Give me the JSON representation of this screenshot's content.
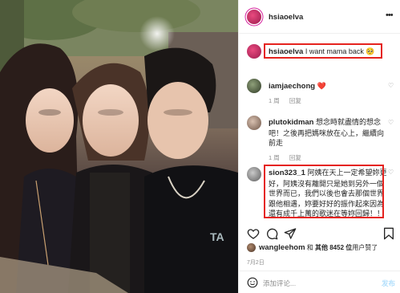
{
  "post": {
    "author": "hsiaoelva",
    "more_icon": "more-horizontal-icon"
  },
  "caption": {
    "user": "hsiaoelva",
    "text": "I want mama back 🥺"
  },
  "comments": [
    {
      "user": "iamjaechong",
      "text": "❤️",
      "time": "1 周",
      "reply": "回复"
    },
    {
      "user": "plutokidman",
      "text": "想念時就盡情的想念吧！之後再把媽咪放在心上，繼續向前走",
      "time": "1 周",
      "reply": "回复"
    },
    {
      "user": "sion323_1",
      "text": "阿姨在天上一定希望妳更好，阿姨沒有離開只是她到另外一個世界而已，我們以後也會去那個世界跟他相遇，妳要好好的振作起來因為還有成千上萬的歌迷在等妳回歸！！加油喔～～～～愛妳"
    }
  ],
  "actions": {
    "like_icon": "heart-outline-icon",
    "comment_icon": "comment-bubble-icon",
    "share_icon": "paper-plane-icon",
    "save_icon": "bookmark-icon"
  },
  "likes": {
    "user": "wangleehom",
    "connector": "和",
    "others": "其他 8452 位",
    "suffix": "用户赞了"
  },
  "date": "7月2日",
  "add_comment": {
    "placeholder": "添加评论...",
    "post_label": "发布",
    "emoji_icon": "smiley-face-icon"
  },
  "colors": {
    "highlight_box": "#e5231f",
    "heart": "#ed4956",
    "muted_text": "#8e8e8e",
    "post_button": "#b2dffc"
  }
}
